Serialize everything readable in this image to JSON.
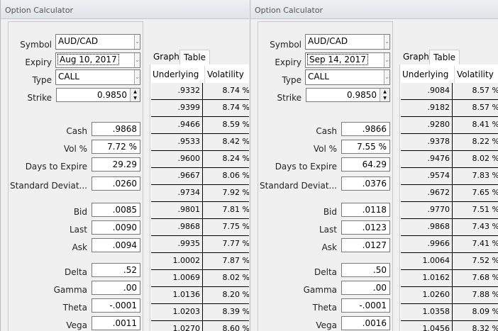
{
  "panels": [
    {
      "title": "Option Calculator",
      "symbol": "AUD/CAD",
      "expiry": "Aug 10, 2017",
      "type": "CALL",
      "strike": "0.9850",
      "tabs": [
        "Graph",
        "Table"
      ],
      "columns": [
        "Underlying",
        "Volatility"
      ],
      "labels": {
        "symbol": "Symbol",
        "expiry": "Expiry",
        "type": "Type",
        "strike": "Strike"
      },
      "fields": [
        {
          "label": "Cash",
          "value": ".9868"
        },
        {
          "label": "Vol %",
          "value": "7.72 %"
        },
        {
          "label": "Days to Expire",
          "value": "29.29"
        },
        {
          "label": "Standard Deviat...",
          "value": ".0260"
        },
        {
          "label": "Bid",
          "value": ".0085"
        },
        {
          "label": "Last",
          "value": ".0090"
        },
        {
          "label": "Ask",
          "value": ".0094"
        },
        {
          "label": "Delta",
          "value": ".52"
        },
        {
          "label": "Gamma",
          "value": ".00"
        },
        {
          "label": "Theta",
          "value": "-.0001"
        },
        {
          "label": "Vega",
          "value": ".0011"
        }
      ],
      "rows": [
        [
          ".9332",
          "8.74 %"
        ],
        [
          ".9399",
          "8.74 %"
        ],
        [
          ".9466",
          "8.59 %"
        ],
        [
          ".9533",
          "8.42 %"
        ],
        [
          ".9600",
          "8.24 %"
        ],
        [
          ".9667",
          "8.06 %"
        ],
        [
          ".9734",
          "7.92 %"
        ],
        [
          ".9801",
          "7.81 %"
        ],
        [
          ".9868",
          "7.75 %"
        ],
        [
          ".9935",
          "7.77 %"
        ],
        [
          "1.0002",
          "7.87 %"
        ],
        [
          "1.0069",
          "8.02 %"
        ],
        [
          "1.0136",
          "8.20 %"
        ],
        [
          "1.0203",
          "8.39 %"
        ],
        [
          "1.0270",
          "8.60 %"
        ]
      ]
    },
    {
      "title": "Option Calculator",
      "symbol": "AUD/CAD",
      "expiry": "Sep 14, 2017",
      "type": "CALL",
      "strike": "0.9850",
      "tabs": [
        "Graph",
        "Table"
      ],
      "columns": [
        "Underlying",
        "Volatility"
      ],
      "labels": {
        "symbol": "Symbol",
        "expiry": "Expiry",
        "type": "Type",
        "strike": "Strike"
      },
      "fields": [
        {
          "label": "Cash",
          "value": ".9866"
        },
        {
          "label": "Vol %",
          "value": "7.55 %"
        },
        {
          "label": "Days to Expire",
          "value": "64.29"
        },
        {
          "label": "Standard Deviat...",
          "value": ".0376"
        },
        {
          "label": "Bid",
          "value": ".0118"
        },
        {
          "label": "Last",
          "value": ".0123"
        },
        {
          "label": "Ask",
          "value": ".0127"
        },
        {
          "label": "Delta",
          "value": ".50"
        },
        {
          "label": "Gamma",
          "value": ".00"
        },
        {
          "label": "Theta",
          "value": "-.0001"
        },
        {
          "label": "Vega",
          "value": ".0016"
        }
      ],
      "rows": [
        [
          ".9084",
          "8.57 %"
        ],
        [
          ".9182",
          "8.57 %"
        ],
        [
          ".9280",
          "8.41 %"
        ],
        [
          ".9378",
          "8.22 %"
        ],
        [
          ".9476",
          "8.02 %"
        ],
        [
          ".9574",
          "7.83 %"
        ],
        [
          ".9672",
          "7.65 %"
        ],
        [
          ".9770",
          "7.51 %"
        ],
        [
          ".9868",
          "7.43 %"
        ],
        [
          ".9966",
          "7.41 %"
        ],
        [
          "1.0064",
          "7.52 %"
        ],
        [
          "1.0162",
          "7.68 %"
        ],
        [
          "1.0260",
          "7.88 %"
        ],
        [
          "1.0358",
          "8.09 %"
        ],
        [
          "1.0456",
          "8.32 %"
        ]
      ]
    }
  ]
}
